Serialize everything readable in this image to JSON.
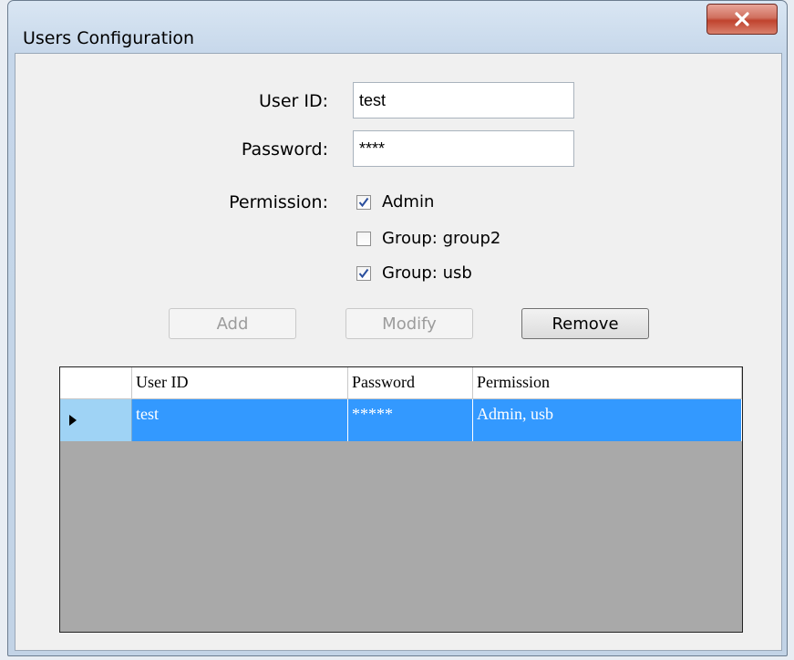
{
  "window": {
    "title": "Users Configuration",
    "close_icon": "close-icon"
  },
  "form": {
    "user_id_label": "User ID:",
    "user_id_value": "test",
    "password_label": "Password:",
    "password_value": "****",
    "permission_label": "Permission:",
    "permissions": [
      {
        "label": "Admin",
        "checked": true
      },
      {
        "label": "Group: group2",
        "checked": false
      },
      {
        "label": "Group: usb",
        "checked": true
      }
    ]
  },
  "buttons": {
    "add_label": "Add",
    "modify_label": "Modify",
    "remove_label": "Remove"
  },
  "grid": {
    "columns": [
      "User ID",
      "Password",
      "Permission"
    ],
    "rows": [
      {
        "user_id": "test",
        "password": "*****",
        "permission": "Admin, usb",
        "selected": true
      }
    ]
  },
  "colors": {
    "selection": "#3399ff",
    "grid_background": "#a9a9a9"
  }
}
